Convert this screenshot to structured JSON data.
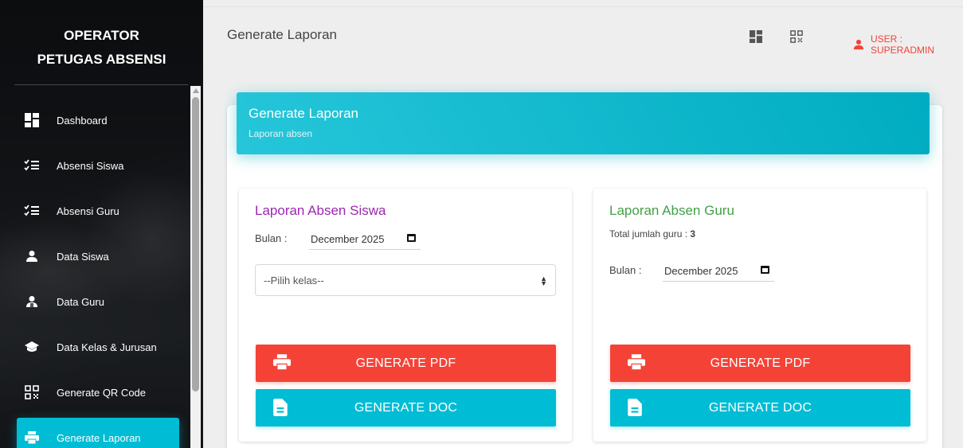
{
  "sidebar": {
    "brand_line1": "OPERATOR",
    "brand_line2": "PETUGAS ABSENSI",
    "items": [
      {
        "label": "Dashboard",
        "icon": "dashboard-icon"
      },
      {
        "label": "Absensi Siswa",
        "icon": "checklist-icon"
      },
      {
        "label": "Absensi Guru",
        "icon": "checklist-icon"
      },
      {
        "label": "Data Siswa",
        "icon": "person-icon"
      },
      {
        "label": "Data Guru",
        "icon": "person-badge-icon"
      },
      {
        "label": "Data Kelas & Jurusan",
        "icon": "graduation-cap-icon"
      },
      {
        "label": "Generate QR Code",
        "icon": "qr-code-icon"
      },
      {
        "label": "Generate Laporan",
        "icon": "printer-icon",
        "active": true
      }
    ]
  },
  "header": {
    "title": "Generate Laporan",
    "user_label": "USER : SUPERADMIN"
  },
  "card": {
    "title": "Generate Laporan",
    "subtitle": "Laporan absen"
  },
  "siswa": {
    "title": "Laporan Absen Siswa",
    "bulan_label": "Bulan :",
    "bulan_value": "December 2025",
    "kelas_placeholder": "--Pilih kelas--",
    "pdf_label": "GENERATE PDF",
    "doc_label": "GENERATE DOC"
  },
  "guru": {
    "title": "Laporan Absen Guru",
    "total_label": "Total jumlah guru : ",
    "total_value": "3",
    "bulan_label": "Bulan :",
    "bulan_value": "December 2025",
    "pdf_label": "GENERATE PDF",
    "doc_label": "GENERATE DOC"
  },
  "colors": {
    "accent": "#00bcd4",
    "danger": "#f44336",
    "siswa_title": "#9c27b0",
    "guru_title": "#43a047"
  }
}
